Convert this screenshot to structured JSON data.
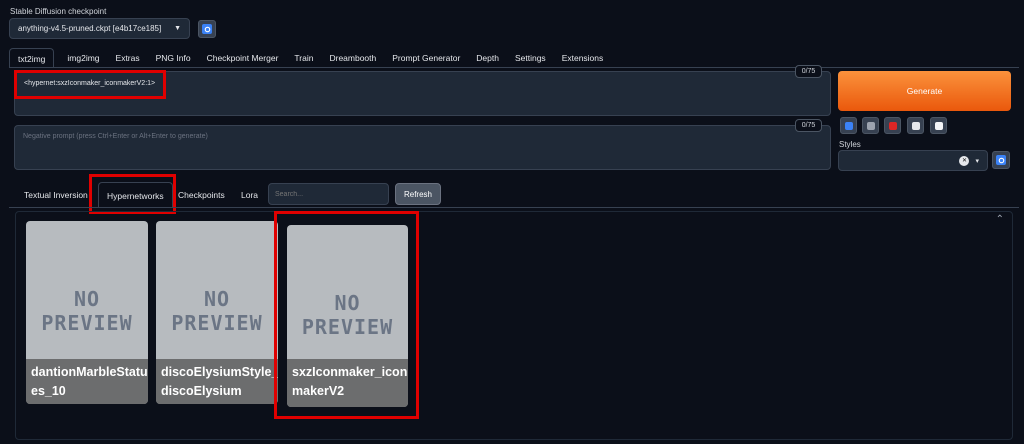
{
  "checkpoint": {
    "label": "Stable Diffusion checkpoint",
    "value": "anything-v4.5-pruned.ckpt [e4b17ce185]",
    "refresh_icon": "refresh-icon"
  },
  "tabs": [
    {
      "label": "txt2img",
      "active": true
    },
    {
      "label": "img2img"
    },
    {
      "label": "Extras"
    },
    {
      "label": "PNG Info"
    },
    {
      "label": "Checkpoint Merger"
    },
    {
      "label": "Train"
    },
    {
      "label": "Dreambooth"
    },
    {
      "label": "Prompt Generator"
    },
    {
      "label": "Depth"
    },
    {
      "label": "Settings"
    },
    {
      "label": "Extensions"
    }
  ],
  "prompt": {
    "value": "<hypernet:sxzIconmaker_iconmakerV2:1>",
    "counter": "0/75"
  },
  "negative_prompt": {
    "placeholder": "Negative prompt (press Ctrl+Enter or Alt+Enter to generate)",
    "counter": "0/75"
  },
  "generate_label": "Generate",
  "tool_icons": [
    "arrow-icon",
    "trash-icon",
    "red-card-icon",
    "clipboard-icon",
    "save-icon"
  ],
  "styles": {
    "label": "Styles",
    "clear_symbol": "✕",
    "dropdown_symbol": "▾"
  },
  "extra_tabs": [
    {
      "label": "Textual Inversion"
    },
    {
      "label": "Hypernetworks",
      "active": true
    },
    {
      "label": "Checkpoints"
    },
    {
      "label": "Lora"
    }
  ],
  "search": {
    "placeholder": "Search..."
  },
  "refresh_label": "Refresh",
  "collapse_symbol": "⌃",
  "cards": [
    {
      "name": "dantionMarbleStatues_10",
      "line1": "dantionMarbleStatu",
      "line2": "es_10"
    },
    {
      "name": "discoElysiumStyle_discoElysium",
      "line1": "discoElysiumStyle_",
      "line2": "discoElysium"
    },
    {
      "name": "sxzIconmaker_iconmakerV2",
      "line1": "sxzIconmaker_icon",
      "line2": "makerV2"
    }
  ],
  "preview_text": {
    "line1": "NO",
    "line2": "PREVIEW"
  },
  "colors": {
    "background": "#0b0f19",
    "accent": "#f97316",
    "highlight": "#e00000"
  }
}
